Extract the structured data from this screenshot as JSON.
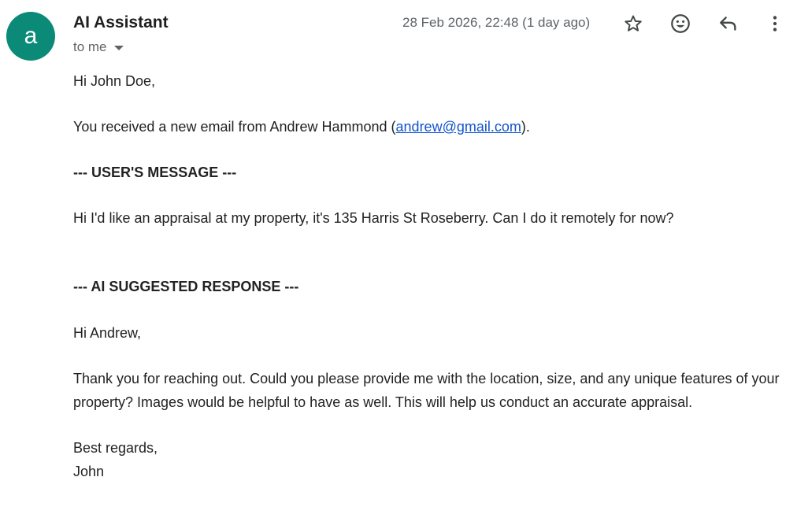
{
  "email": {
    "avatar_letter": "a",
    "avatar_color": "#0b8a78",
    "sender_name": "AI Assistant",
    "recipient_label": "to me",
    "timestamp": "28 Feb 2026, 22:48 (1 day ago)",
    "icons": {
      "star": "star-icon",
      "emoji": "emoji-react-icon",
      "reply": "reply-icon",
      "more": "more-vert-icon"
    }
  },
  "message": {
    "greeting": "Hi John Doe,",
    "notice_prefix": "You received a new email from Andrew Hammond (",
    "notice_email": "andrew@gmail.com",
    "notice_suffix": ").",
    "user_section_heading": "--- USER'S MESSAGE ---",
    "user_message": "Hi I'd like an appraisal at my property, it's 135 Harris St Roseberry. Can I do it remotely for now?",
    "ai_section_heading": "--- AI SUGGESTED RESPONSE ---",
    "ai_greeting": "Hi Andrew,",
    "ai_body": "Thank you for reaching out. Could you please provide me with the location, size, and any unique features of your property? Images would be helpful to have as well. This will help us conduct an accurate appraisal.",
    "closing": "Best regards,",
    "signature": "John"
  },
  "colors": {
    "link": "#1155cc",
    "muted_text": "#5f6368",
    "body_text": "#222222"
  }
}
